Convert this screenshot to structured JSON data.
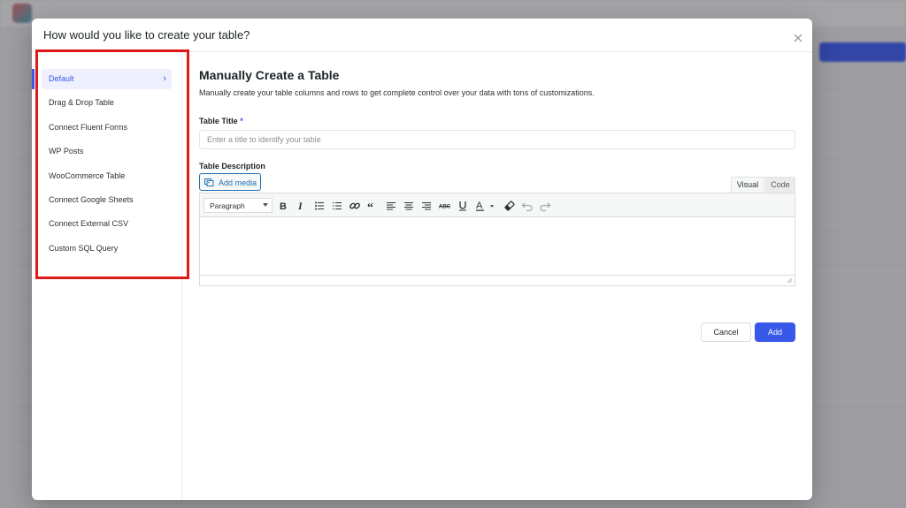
{
  "modal": {
    "title": "How would you like to create your table?",
    "close_icon": "close-icon"
  },
  "sidebar": {
    "items": [
      {
        "label": "Default",
        "active": true
      },
      {
        "label": "Drag & Drop Table"
      },
      {
        "label": "Connect Fluent Forms"
      },
      {
        "label": "WP Posts"
      },
      {
        "label": "WooCommerce Table"
      },
      {
        "label": "Connect Google Sheets"
      },
      {
        "label": "Connect External CSV"
      },
      {
        "label": "Custom SQL Query"
      }
    ],
    "highlight_color": "#e01818"
  },
  "main": {
    "title": "Manually Create a Table",
    "subtitle": "Manually create your table columns and rows to get complete control over your data with tons of customizations.",
    "table_title": {
      "label": "Table Title",
      "required_mark": "*",
      "placeholder": "Enter a title to identify your table",
      "value": ""
    },
    "table_description": {
      "label": "Table Description",
      "add_media_label": "Add media",
      "tabs": [
        "Visual",
        "Code"
      ],
      "active_tab": "Visual",
      "format_select": "Paragraph",
      "toolbar_icons": [
        "bold-icon",
        "italic-icon",
        "bullet-list-icon",
        "numbered-list-icon",
        "link-icon",
        "blockquote-icon",
        "align-left-icon",
        "align-center-icon",
        "align-right-icon",
        "strikethrough-icon",
        "underline-icon",
        "text-color-icon",
        "eraser-icon",
        "undo-icon",
        "redo-icon"
      ]
    },
    "actions": {
      "cancel_label": "Cancel",
      "add_label": "Add"
    }
  },
  "colors": {
    "accent": "#3858e9",
    "link": "#2271b1"
  }
}
